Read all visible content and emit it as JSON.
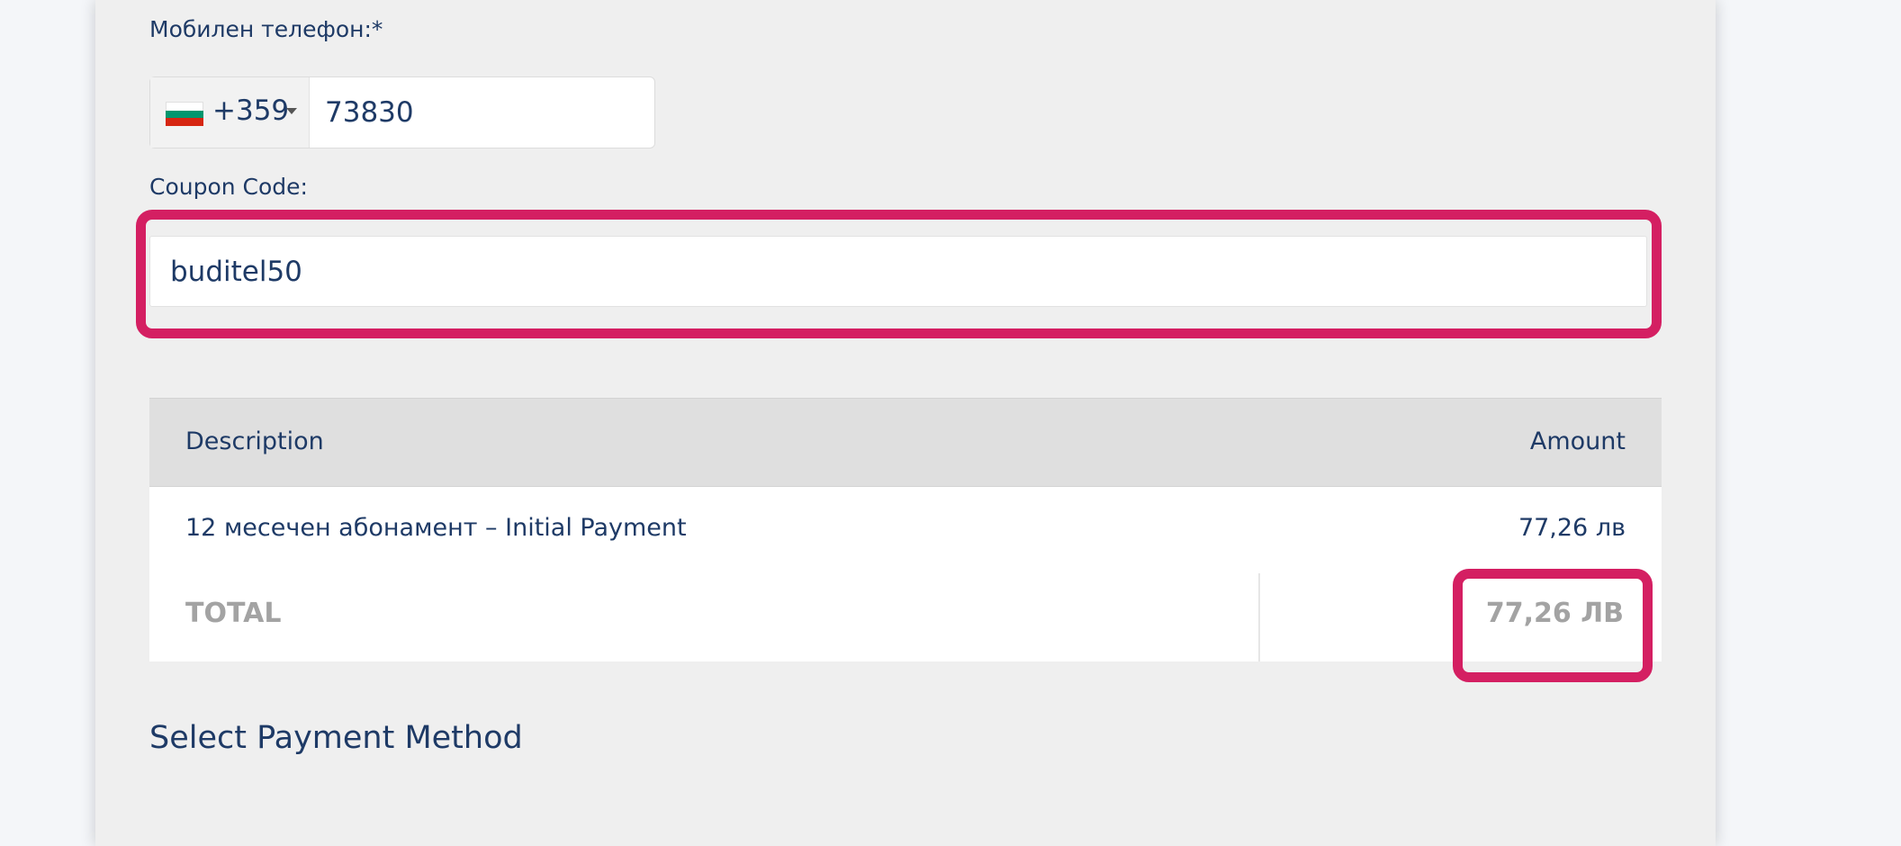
{
  "form": {
    "phone_label": "Мобилен телефон:*",
    "phone_country_code": "+359",
    "phone_flag_colors": [
      "#ffffff",
      "#00966e",
      "#d62612"
    ],
    "phone_value": "73830",
    "coupon_label": "Coupon Code:",
    "coupon_value": "buditel50"
  },
  "table": {
    "headers": {
      "description": "Description",
      "amount": "Amount"
    },
    "rows": [
      {
        "description": "12 месечен абонамент – Initial Payment",
        "amount": "77,26 лв"
      }
    ],
    "total": {
      "label": "TOTAL",
      "amount": "77,26 ЛВ"
    }
  },
  "payment": {
    "heading": "Select Payment Method"
  },
  "colors": {
    "highlight": "#d41f62",
    "text": "#1e3a66",
    "total_text": "#a3a3a3"
  }
}
